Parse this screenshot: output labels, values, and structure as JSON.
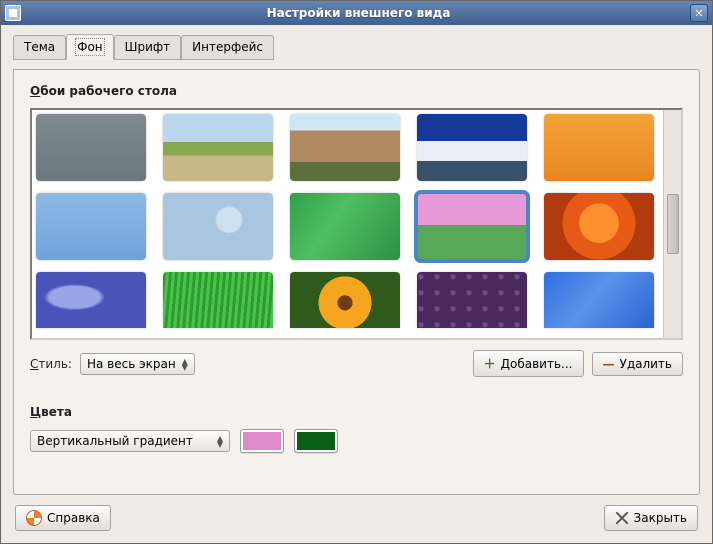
{
  "window": {
    "title": "Настройки внешнего вида"
  },
  "tabs": {
    "theme": "Тема",
    "background": "Фон",
    "font": "Шрифт",
    "interface": "Интерфейс",
    "active": "background"
  },
  "section": {
    "wallpapers_label": "Обои рабочего стола",
    "colors_label": "Цвета"
  },
  "style": {
    "label": "Стиль:",
    "value": "На весь экран"
  },
  "buttons": {
    "add": "Добавить...",
    "remove": "Удалить",
    "help": "Справка",
    "close": "Закрыть"
  },
  "gradient": {
    "value": "Вертикальный градиент"
  },
  "swatches": {
    "color1": "#de8acb",
    "color2": "#0d5e17"
  },
  "thumbs": [
    {
      "id": "solid-gray",
      "bg": "linear-gradient(#7e8a90,#6b777d)",
      "selected": false
    },
    {
      "id": "countryside",
      "bg": "linear-gradient(#bcd5ef 0 42%, #8aa851 42% 62%, #c8b887 62% 100%)",
      "selected": false
    },
    {
      "id": "canyon",
      "bg": "linear-gradient(#cfe6f5 0 25%, #b08963 25% 72%, #5e6f3e 72% 100%)",
      "selected": false
    },
    {
      "id": "mountain",
      "bg": "linear-gradient(#153a9a 0 40%, #e8edf6 40% 70%, #3a516c 70% 100%)",
      "selected": false
    },
    {
      "id": "orange-grad",
      "bg": "linear-gradient(#f3a43a,#e8861f)",
      "selected": false
    },
    {
      "id": "blue-grad",
      "bg": "linear-gradient(#8fb9e6,#6fa3dc)",
      "selected": false
    },
    {
      "id": "debian-swirl",
      "bg": "radial-gradient(circle at 60% 40%, #cfe0ef 0 16%, #a9c6e1 18% 100%)",
      "selected": false
    },
    {
      "id": "green-wave",
      "bg": "linear-gradient(125deg,#2fa04a,#4fbf63 40%,#2e8f44)",
      "selected": false
    },
    {
      "id": "pink-green-plants",
      "bg": "linear-gradient(#e69ad8 0 48%, #58a85a 48% 100%)",
      "selected": true
    },
    {
      "id": "orange-flower",
      "bg": "radial-gradient(circle at 50% 45%, #ff8f2a 0 30%, #e65a16 30% 55%, #b13a0e 55% 100%)",
      "selected": false
    },
    {
      "id": "blue-abstract",
      "bg": "radial-gradient(ellipse at 35% 45%, #9aa4e8 0 25%, #4a54b8 30% 100%)",
      "selected": false
    },
    {
      "id": "grass",
      "bg": "repeating-linear-gradient(95deg,#2f9a2f 0 3px,#49c449 3px 6px)",
      "selected": false
    },
    {
      "id": "sunflower",
      "bg": "radial-gradient(circle at 50% 55%, #6e3d14 0 12%, #f6a51f 12% 42%, #2f5a1c 42% 100%)",
      "selected": false
    },
    {
      "id": "purple-dots",
      "bg": "radial-gradient(circle at 25% 30%, #7a4a9a 0 2px, transparent 3px) 0 0/16px 16px, #4a2a5e",
      "selected": false
    },
    {
      "id": "blue-wave",
      "bg": "linear-gradient(130deg,#2f6fe0,#5a93ea 45%,#2a63d4)",
      "selected": false
    }
  ]
}
